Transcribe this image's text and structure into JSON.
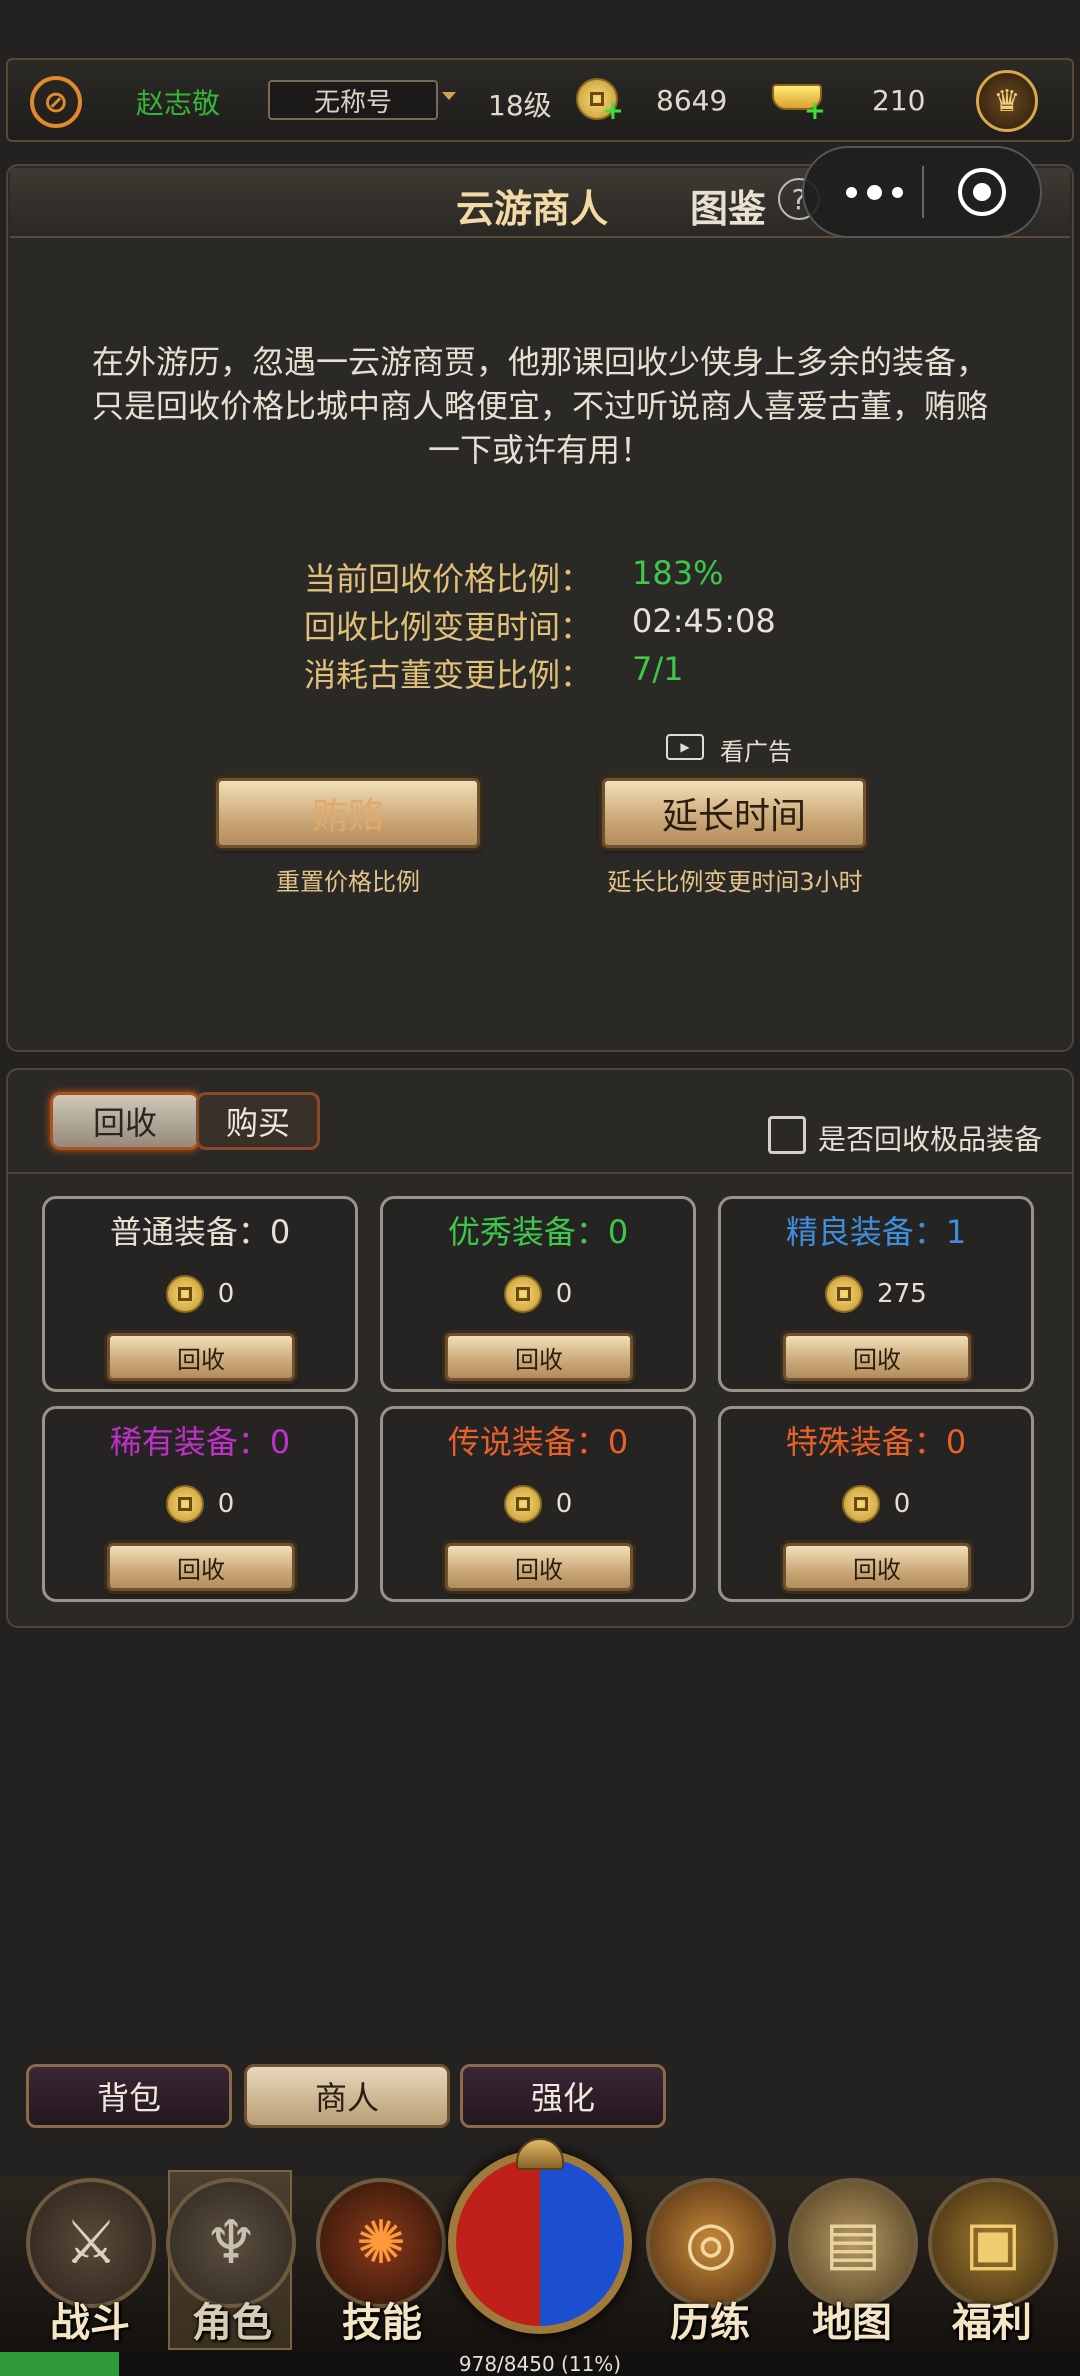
{
  "topbar": {
    "username": "赵志敬",
    "title_select": "无称号",
    "level": "18级",
    "copper": "8649",
    "gold": "210"
  },
  "header": {
    "tab_merchant": "云游商人",
    "tab_catalog": "图鉴",
    "help": "?"
  },
  "merchant": {
    "description_lines": [
      "在外游历，忽遇一云游商贾，他那课回收少侠身上多余的装备，",
      "只是回收价格比城中商人略便宜，不过听说商人喜爱古董，贿赂",
      "一下或许有用！"
    ],
    "stats": [
      {
        "label": "当前回收价格比例：",
        "value": "183%"
      },
      {
        "label": "回收比例变更时间：",
        "value": "02:45:08"
      },
      {
        "label": "消耗古董变更比例：",
        "value": "7/1"
      }
    ],
    "ad_label": "看广告",
    "bribe_button": "贿赂",
    "bribe_sub": "重置价格比例",
    "extend_button": "延长时间",
    "extend_sub": "延长比例变更时间3小时"
  },
  "recycle": {
    "tab_recycle": "回收",
    "tab_buy": "购买",
    "checkbox_label": "是否回收极品装备",
    "items": [
      {
        "title": "普通装备：0",
        "price": "0",
        "button": "回收",
        "color": "#e6e0d2"
      },
      {
        "title": "优秀装备：0",
        "price": "0",
        "button": "回收",
        "color": "#3cc84a"
      },
      {
        "title": "精良装备：1",
        "price": "275",
        "button": "回收",
        "color": "#3e8ede"
      },
      {
        "title": "稀有装备：0",
        "price": "0",
        "button": "回收",
        "color": "#c030c8"
      },
      {
        "title": "传说装备：0",
        "price": "0",
        "button": "回收",
        "color": "#e8602a"
      },
      {
        "title": "特殊装备：0",
        "price": "0",
        "button": "回收",
        "color": "#e8602a"
      }
    ]
  },
  "bottom_tabs": [
    "背包",
    "商人",
    "强化"
  ],
  "nav": [
    "战斗",
    "角色",
    "技能",
    "历练",
    "地图",
    "福利"
  ],
  "exp": "978/8450 (11%)",
  "exp_progress": 0.11
}
